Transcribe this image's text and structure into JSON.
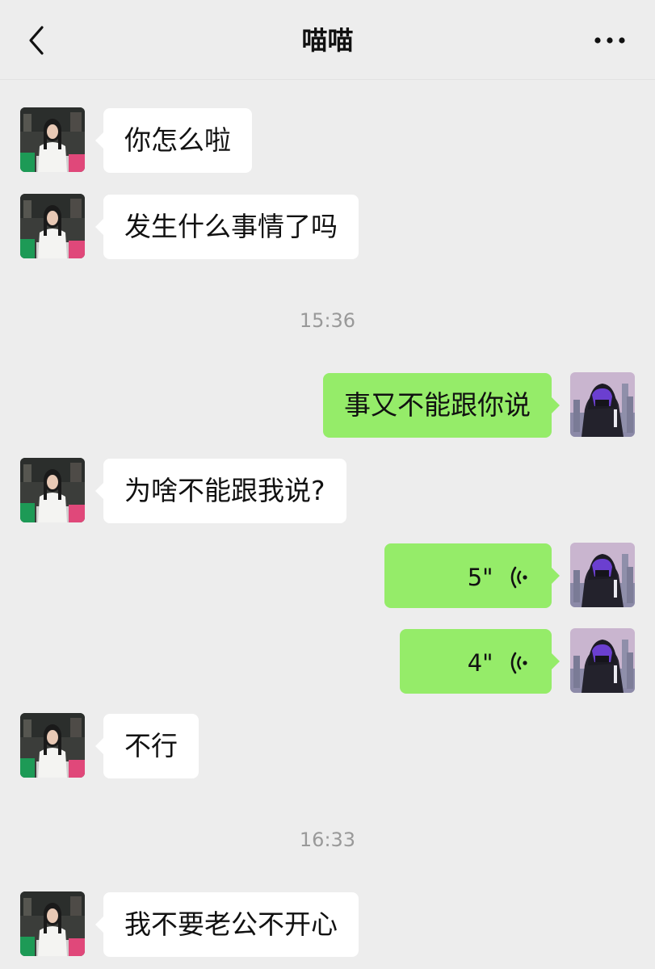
{
  "header": {
    "title": "喵喵",
    "back_icon": "chevron-left-icon",
    "more_icon": "more-dots-icon"
  },
  "messages": [
    {
      "side": "left",
      "text": "你怎么啦"
    },
    {
      "side": "left",
      "text": "发生什么事情了吗"
    },
    {
      "timestamp": "15:36"
    },
    {
      "side": "right",
      "text": "事又不能跟你说"
    },
    {
      "side": "left",
      "text": "为啥不能跟我说?"
    },
    {
      "side": "right",
      "type": "voice",
      "duration": "5\""
    },
    {
      "side": "right",
      "type": "voice",
      "duration": "4\""
    },
    {
      "side": "left",
      "text": "不行"
    },
    {
      "timestamp": "16:33"
    },
    {
      "side": "left",
      "text": "我不要老公不开心"
    }
  ],
  "colors": {
    "background": "#ededed",
    "left_bubble": "#ffffff",
    "right_bubble": "#95ec69",
    "timestamp": "#999999"
  }
}
